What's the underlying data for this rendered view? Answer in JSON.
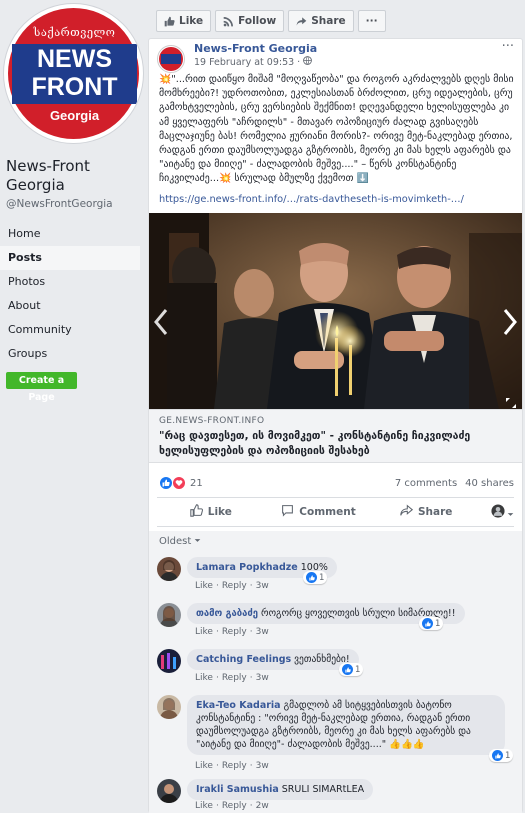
{
  "page": {
    "logo": {
      "top_text": "საქართველო",
      "line1": "NEWS",
      "line2": "FRONT",
      "line3": "Georgia"
    },
    "name": "News-Front Georgia",
    "handle": "@NewsFrontGeorgia",
    "nav": [
      "Home",
      "Posts",
      "Photos",
      "About",
      "Community",
      "Groups"
    ],
    "active_nav": "Posts",
    "create_label": "Create a Page"
  },
  "actionbar": {
    "like": "Like",
    "follow": "Follow",
    "share": "Share",
    "more": "···"
  },
  "post": {
    "author": "News-Front Georgia",
    "time": "19 February at 09:53 · ",
    "text": "💥\"...რით დაიწყო მიშამ \"მოღვაწეობა\" და როგორ აკრძალვებს დღეს მისი მომხრეები?! უდროთობით, ეკლესიასთან ბრძოლით, ცრუ იდეალების, ცრუ გამოხტველების, ცრუ ვერსიების შექმნით! დღევანდელი ხელისუფლება კი ამ ყველაფერს \"აჩრდილს\" - მთავარ ოპოზიციურ ძალად გვისაღებს მაცლაჯიუნე ბას! რომელია ჟურიანი მორის?- ორივე მეტ-ნაკლებად ერთია, რადგან ერთი დაუმსოლუადგა გზტროიბს, მეორე კი მას ხელს აფარებს და \"აიტანე და მიიღე\" - ძალადობის მეშვე....\" – წერს კონსტანტინე ჩიკვილაძე...💥 სრულად ბმულზე ქვემოთ ⬇️",
    "link": "https://ge.news-front.info/…/rats-davtheseth-is-movimketh-…/",
    "preview": {
      "domain": "GE.NEWS-FRONT.INFO",
      "title": "\"რაც დავთესეთ, ის მოვიმკეთ\" - კონსტანტინე ჩიკვილაძე ხელისუფლების და ოპოზიციის შესახებ"
    },
    "reactions_count": "21",
    "comments_count": "7 comments",
    "shares_count": "40 shares",
    "actions": {
      "like": "Like",
      "comment": "Comment",
      "share": "Share"
    },
    "sort_label": "Oldest"
  },
  "comments": [
    {
      "name": "Lamara Popkhadze",
      "text": "100%",
      "time": "3w",
      "likes": "1"
    },
    {
      "name": "თამო გაბაძე",
      "text": "როგორც ყოველთვის სრული სიმართლე!!",
      "time": "3w",
      "likes": "1"
    },
    {
      "name": "Catching Feelings",
      "text": "ვეთანხმები!",
      "time": "3w",
      "likes": "1"
    },
    {
      "name": "Eka-Teo Kadaria",
      "text": "გმადლობ ამ სიტყვებისთვის ბატონო კონსტანტინე : \"ორივე მეტ-ნაკლებად ერთია, რადგან ერთი დაუმსოლუადგა გზტროიბს, მეორე კი მას ხელს აფარებს და \"აიტანე და მიიღე\"- ძალადობის მეშვე....\" 👍👍👍",
      "time": "3w",
      "likes": "1"
    },
    {
      "name": "Irakli Samushia",
      "text": "SRULI SIMARtLEA",
      "time": "2w",
      "likes": ""
    }
  ],
  "comment_meta": {
    "like": "Like",
    "reply": "Reply",
    "dot": "·"
  },
  "colors": {
    "fb_blue": "#385898",
    "brand_red": "#d11f2a",
    "brand_navy": "#1f3c8c",
    "create_green": "#42b72a"
  }
}
